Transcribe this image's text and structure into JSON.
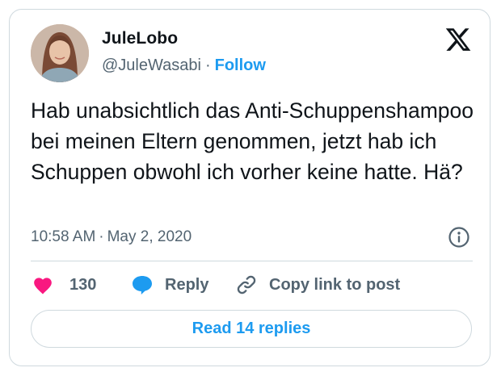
{
  "tweet": {
    "author": {
      "display_name": "JuleLobo",
      "handle": "@JuleWasabi",
      "separator": "·",
      "follow_label": "Follow",
      "avatar_icon": "avatar-photo"
    },
    "logo_icon": "x-logo-icon",
    "text": "Hab unabsichtlich das Anti-Schuppenshampoo bei meinen Eltern genommen, jetzt hab ich Schuppen obwohl ich vorher keine hatte. Hä?",
    "time": "10:58 AM",
    "meta_separator": "·",
    "date": "May 2, 2020",
    "info_icon": "info-icon",
    "actions": {
      "like_count": "130",
      "like_icon": "heart-icon",
      "reply_label": "Reply",
      "reply_icon": "speech-bubble-icon",
      "copy_label": "Copy link to post",
      "copy_icon": "link-icon"
    },
    "replies_button_label": "Read 14 replies"
  },
  "colors": {
    "accent": "#1d9bf0",
    "like": "#f91880",
    "text_primary": "#0f1419",
    "text_secondary": "#536471",
    "border": "#cfd9de"
  }
}
